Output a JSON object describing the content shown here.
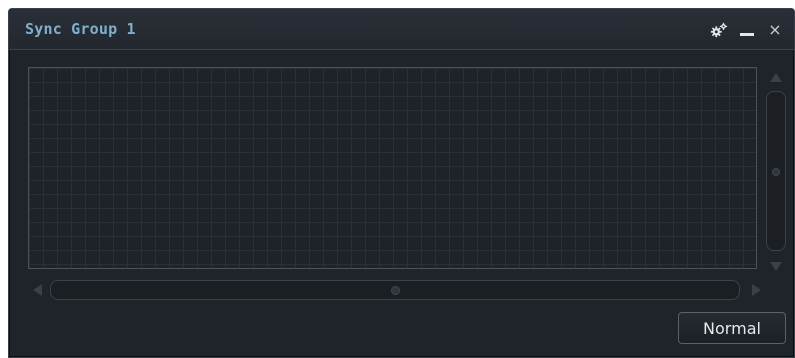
{
  "window": {
    "title": "Sync Group 1",
    "controls": {
      "settings_icon": "gear-icon",
      "minimize_icon": "minimize-icon",
      "close_icon": "close-icon",
      "close_glyph": "×"
    }
  },
  "footer": {
    "mode_label": "Normal"
  },
  "colors": {
    "title_text": "#7fb0cc",
    "panel_bg": "#1f232a",
    "grid_line": "#29303a"
  }
}
